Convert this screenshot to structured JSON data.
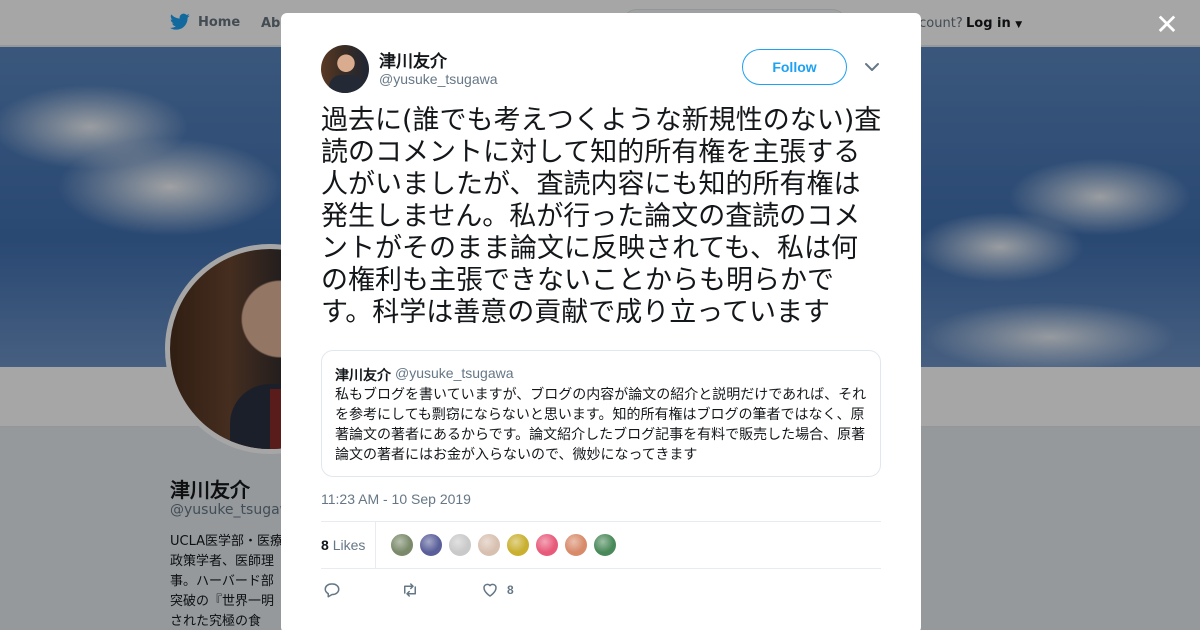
{
  "background_page": {
    "nav": {
      "home_label": "Home",
      "about_label": "Abo",
      "account_text": "ccount?",
      "login_label": "Log in"
    },
    "profile": {
      "name": "津川友介",
      "handle": "@yusuke_tsugaw",
      "bio": "UCLA医学部・医療政策学者、医師理事。ハーバード部突破の『世界一明された究極の食"
    }
  },
  "modal": {
    "author": {
      "name": "津川友介",
      "handle": "@yusuke_tsugawa",
      "follow_label": "Follow"
    },
    "tweet_text": "過去に(誰でも考えつくような新規性のない)査読のコメントに対して知的所有権を主張する人がいましたが、査読内容にも知的所有権は発生しません。私が行った論文の査読のコメントがそのまま論文に反映されても、私は何の権利も主張できないことからも明らかです。科学は善意の貢献で成り立っています",
    "quoted_tweet": {
      "name": "津川友介",
      "handle": "@yusuke_tsugawa",
      "text": "私もブログを書いていますが、ブログの内容が論文の紹介と説明だけであれば、それを参考にしても剽窃にならないと思います。知的所有権はブログの筆者ではなく、原著論文の著者にあるからです。論文紹介したブログ記事を有料で販売した場合、原著論文の著者にはお金が入らないので、微妙になってきます"
    },
    "timestamp": "11:23 AM - 10 Sep 2019",
    "likes": {
      "count": "8",
      "label": "Likes"
    },
    "liker_colors": [
      "#7a8a6a",
      "#5a5f9a",
      "#c9c9c9",
      "#d8c0b0",
      "#c9b030",
      "#e85a7a",
      "#d88a6a",
      "#4a8a5a"
    ],
    "actions": {
      "like_count": "8"
    }
  }
}
